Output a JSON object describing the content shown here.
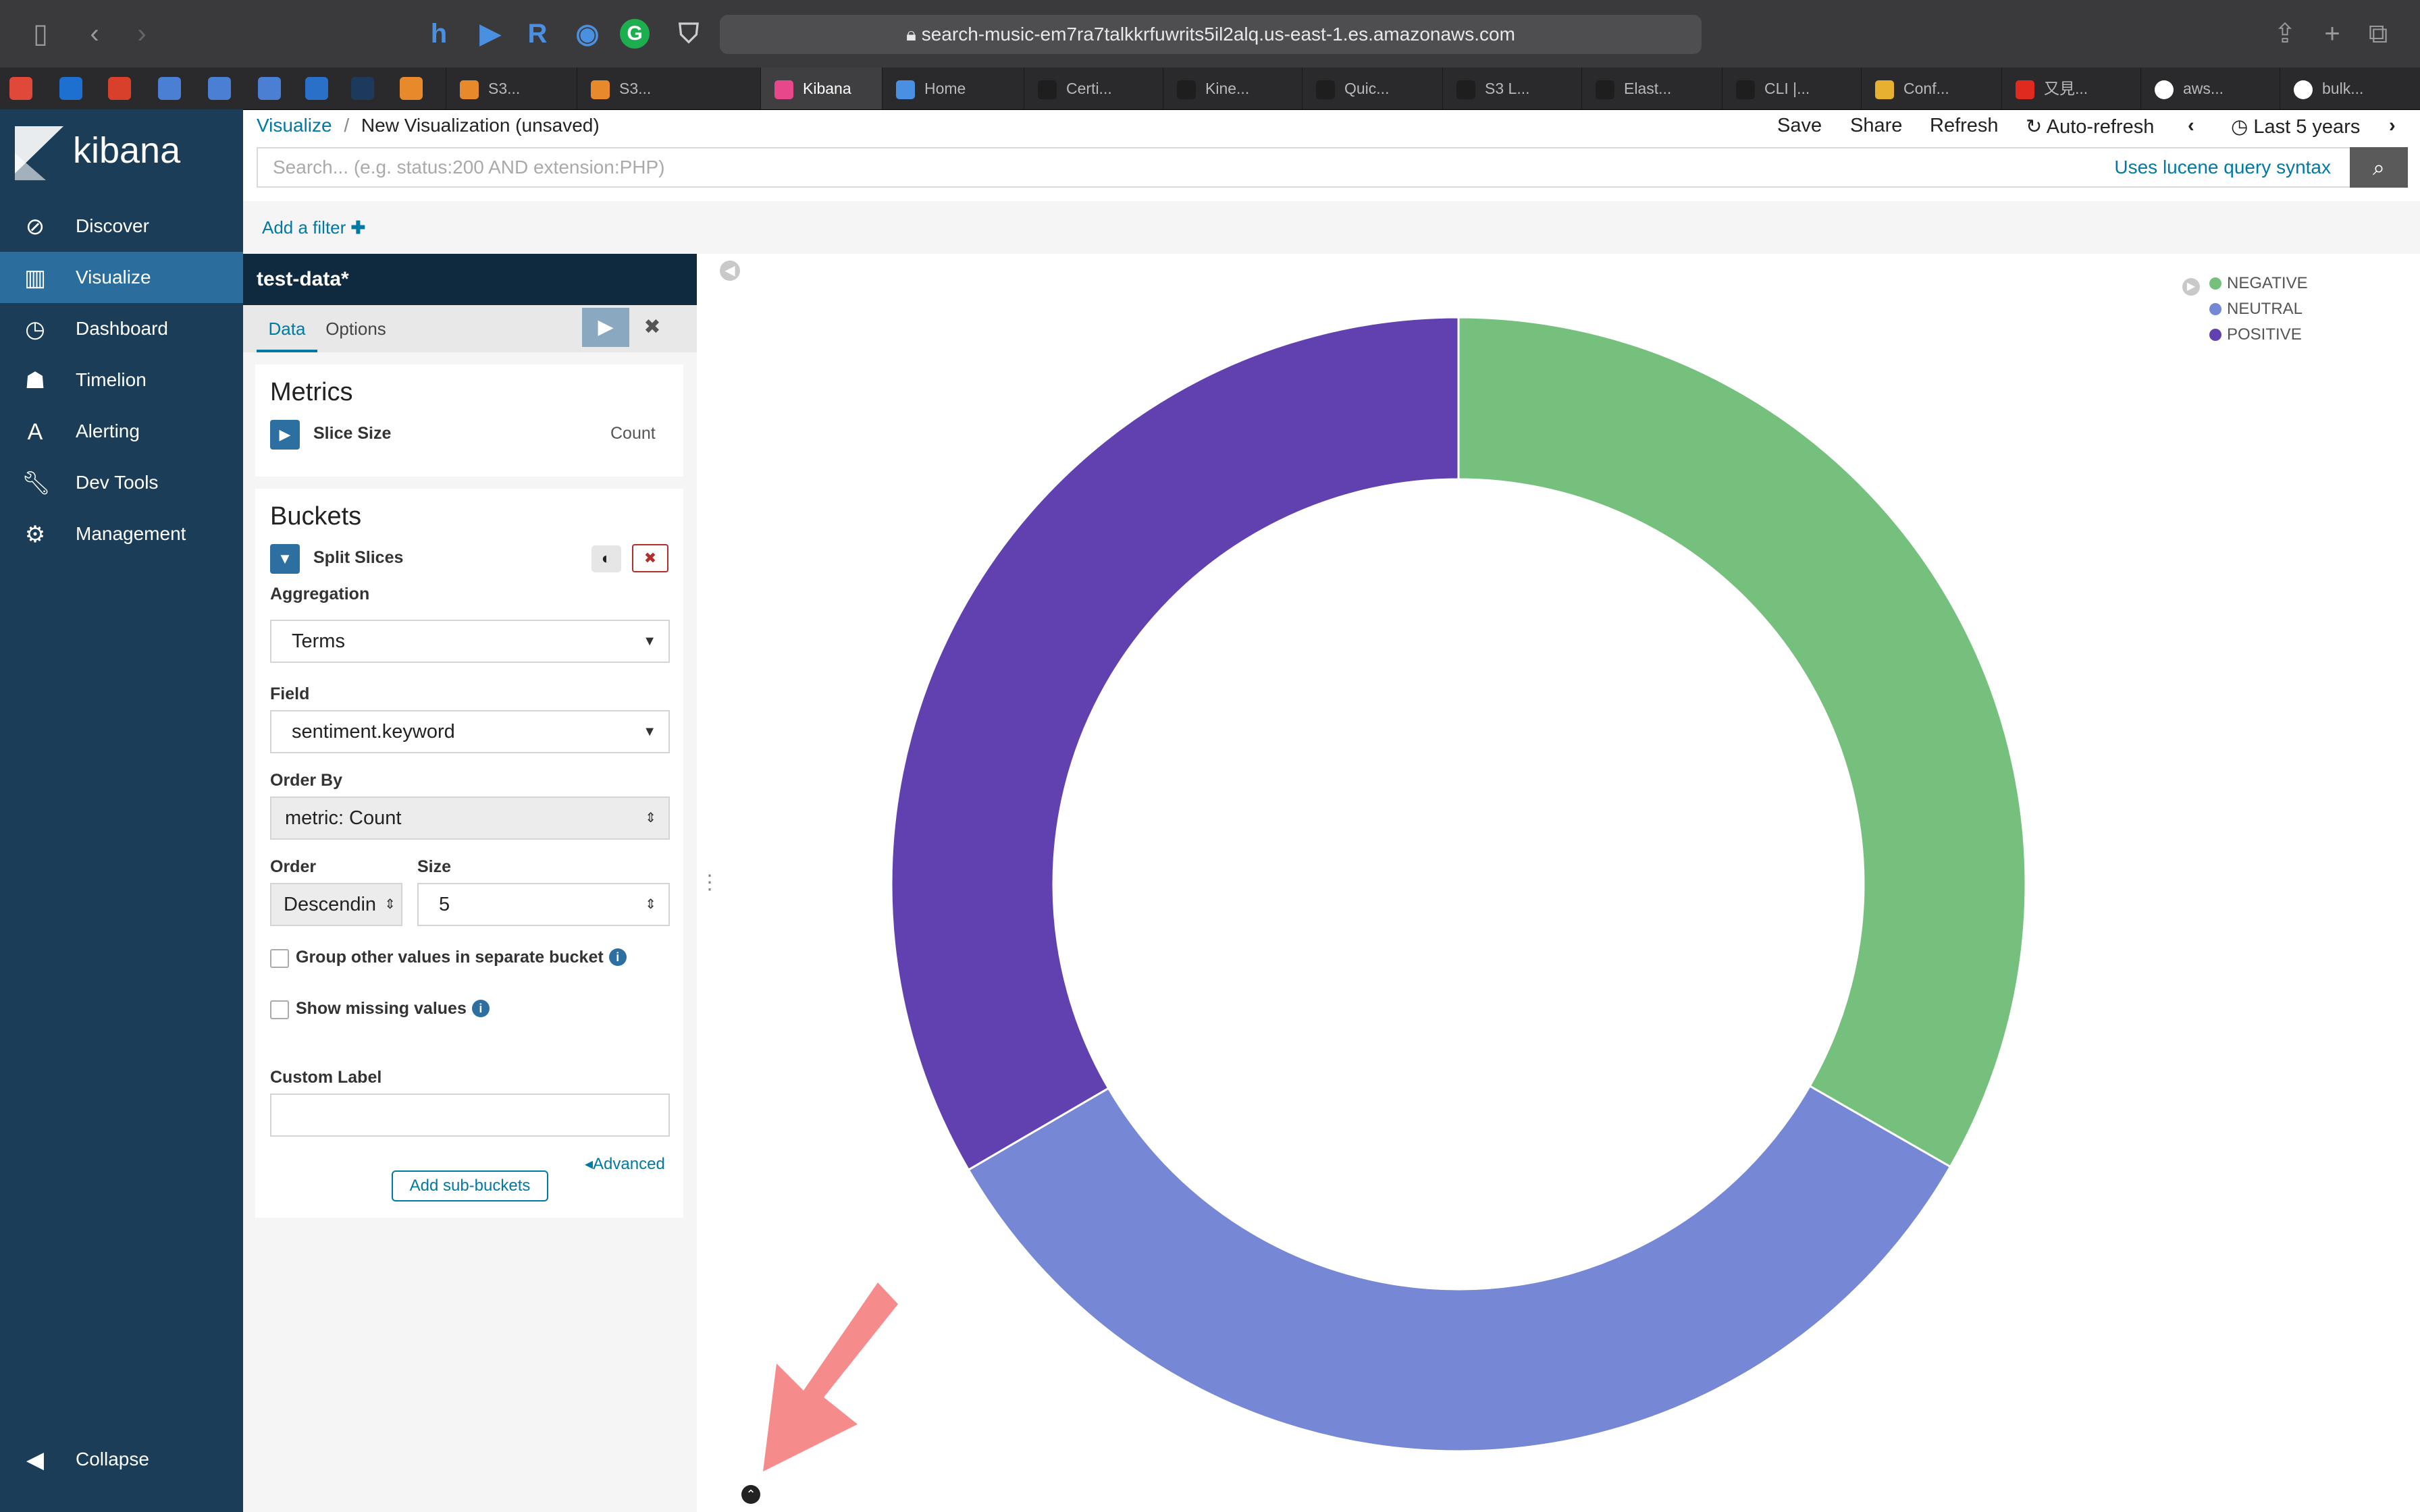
{
  "browser": {
    "url": "search-music-em7ra7talkkrfuwrits5il2alq.us-east-1.es.amazonaws.com",
    "tabs": [
      "S3...",
      "S3...",
      "Kibana",
      "Home",
      "Certi...",
      "Kine...",
      "Quic...",
      "S3 L...",
      "Elast...",
      "CLI |...",
      "Conf...",
      "又見...",
      "aws...",
      "bulk..."
    ]
  },
  "sidebar": {
    "brand": "kibana",
    "items": [
      {
        "label": "Discover",
        "icon": "compass-icon"
      },
      {
        "label": "Visualize",
        "icon": "bar-chart-icon"
      },
      {
        "label": "Dashboard",
        "icon": "dashboard-icon"
      },
      {
        "label": "Timelion",
        "icon": "timelion-icon"
      },
      {
        "label": "Alerting",
        "icon": "alerting-icon"
      },
      {
        "label": "Dev Tools",
        "icon": "wrench-icon"
      },
      {
        "label": "Management",
        "icon": "gear-icon"
      }
    ],
    "collapse": "Collapse",
    "active": "Visualize"
  },
  "header": {
    "breadcrumb_link": "Visualize",
    "breadcrumb_sep": "/",
    "breadcrumb_current": "New Visualization (unsaved)",
    "save": "Save",
    "share": "Share",
    "refresh": "Refresh",
    "auto_refresh": "Auto-refresh",
    "time_range": "Last 5 years"
  },
  "query": {
    "placeholder": "Search... (e.g. status:200 AND extension:PHP)",
    "syntax_link": "Uses lucene query syntax",
    "add_filter": "Add a filter"
  },
  "editor": {
    "index": "test-data*",
    "tabs": [
      "Data",
      "Options"
    ],
    "metrics": {
      "title": "Metrics",
      "slice_size": "Slice Size",
      "slice_value": "Count"
    },
    "buckets": {
      "title": "Buckets",
      "split": "Split Slices",
      "aggregation_label": "Aggregation",
      "aggregation_value": "Terms",
      "field_label": "Field",
      "field_value": "sentiment.keyword",
      "order_by_label": "Order By",
      "order_by_value": "metric: Count",
      "order_label": "Order",
      "order_value": "Descendin",
      "size_label": "Size",
      "size_value": "5",
      "group_other": "Group other values in separate bucket",
      "show_missing": "Show missing values",
      "custom_label": "Custom Label",
      "custom_label_value": "",
      "advanced": "Advanced",
      "add_sub": "Add sub-buckets"
    }
  },
  "chart_data": {
    "type": "pie",
    "donut": true,
    "categories": [
      "NEGATIVE",
      "NEUTRAL",
      "POSITIVE"
    ],
    "values": [
      33.3,
      33.3,
      33.4
    ],
    "colors": [
      "#76c07e",
      "#7688d5",
      "#6141b0"
    ],
    "legend": "top-right"
  }
}
